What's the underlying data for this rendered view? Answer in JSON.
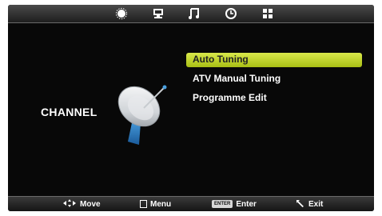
{
  "tabs": [
    {
      "icon": "picture-icon",
      "active": false
    },
    {
      "icon": "pc-setup-icon",
      "active": false
    },
    {
      "icon": "sound-icon",
      "active": false
    },
    {
      "icon": "time-icon",
      "active": false
    },
    {
      "icon": "channel-icon",
      "active": true
    }
  ],
  "section": {
    "title": "CHANNEL",
    "icon": "satellite-dish-icon"
  },
  "menu": {
    "items": [
      {
        "label": "Auto Tuning",
        "selected": true
      },
      {
        "label": "ATV Manual Tuning",
        "selected": false
      },
      {
        "label": "Programme Edit",
        "selected": false
      }
    ]
  },
  "footer": {
    "move_label": "Move",
    "menu_label": "Menu",
    "enter_key": "ENTER",
    "enter_label": "Enter",
    "exit_label": "Exit"
  },
  "colors": {
    "highlight": "#c8dc2c",
    "background": "#080808"
  }
}
